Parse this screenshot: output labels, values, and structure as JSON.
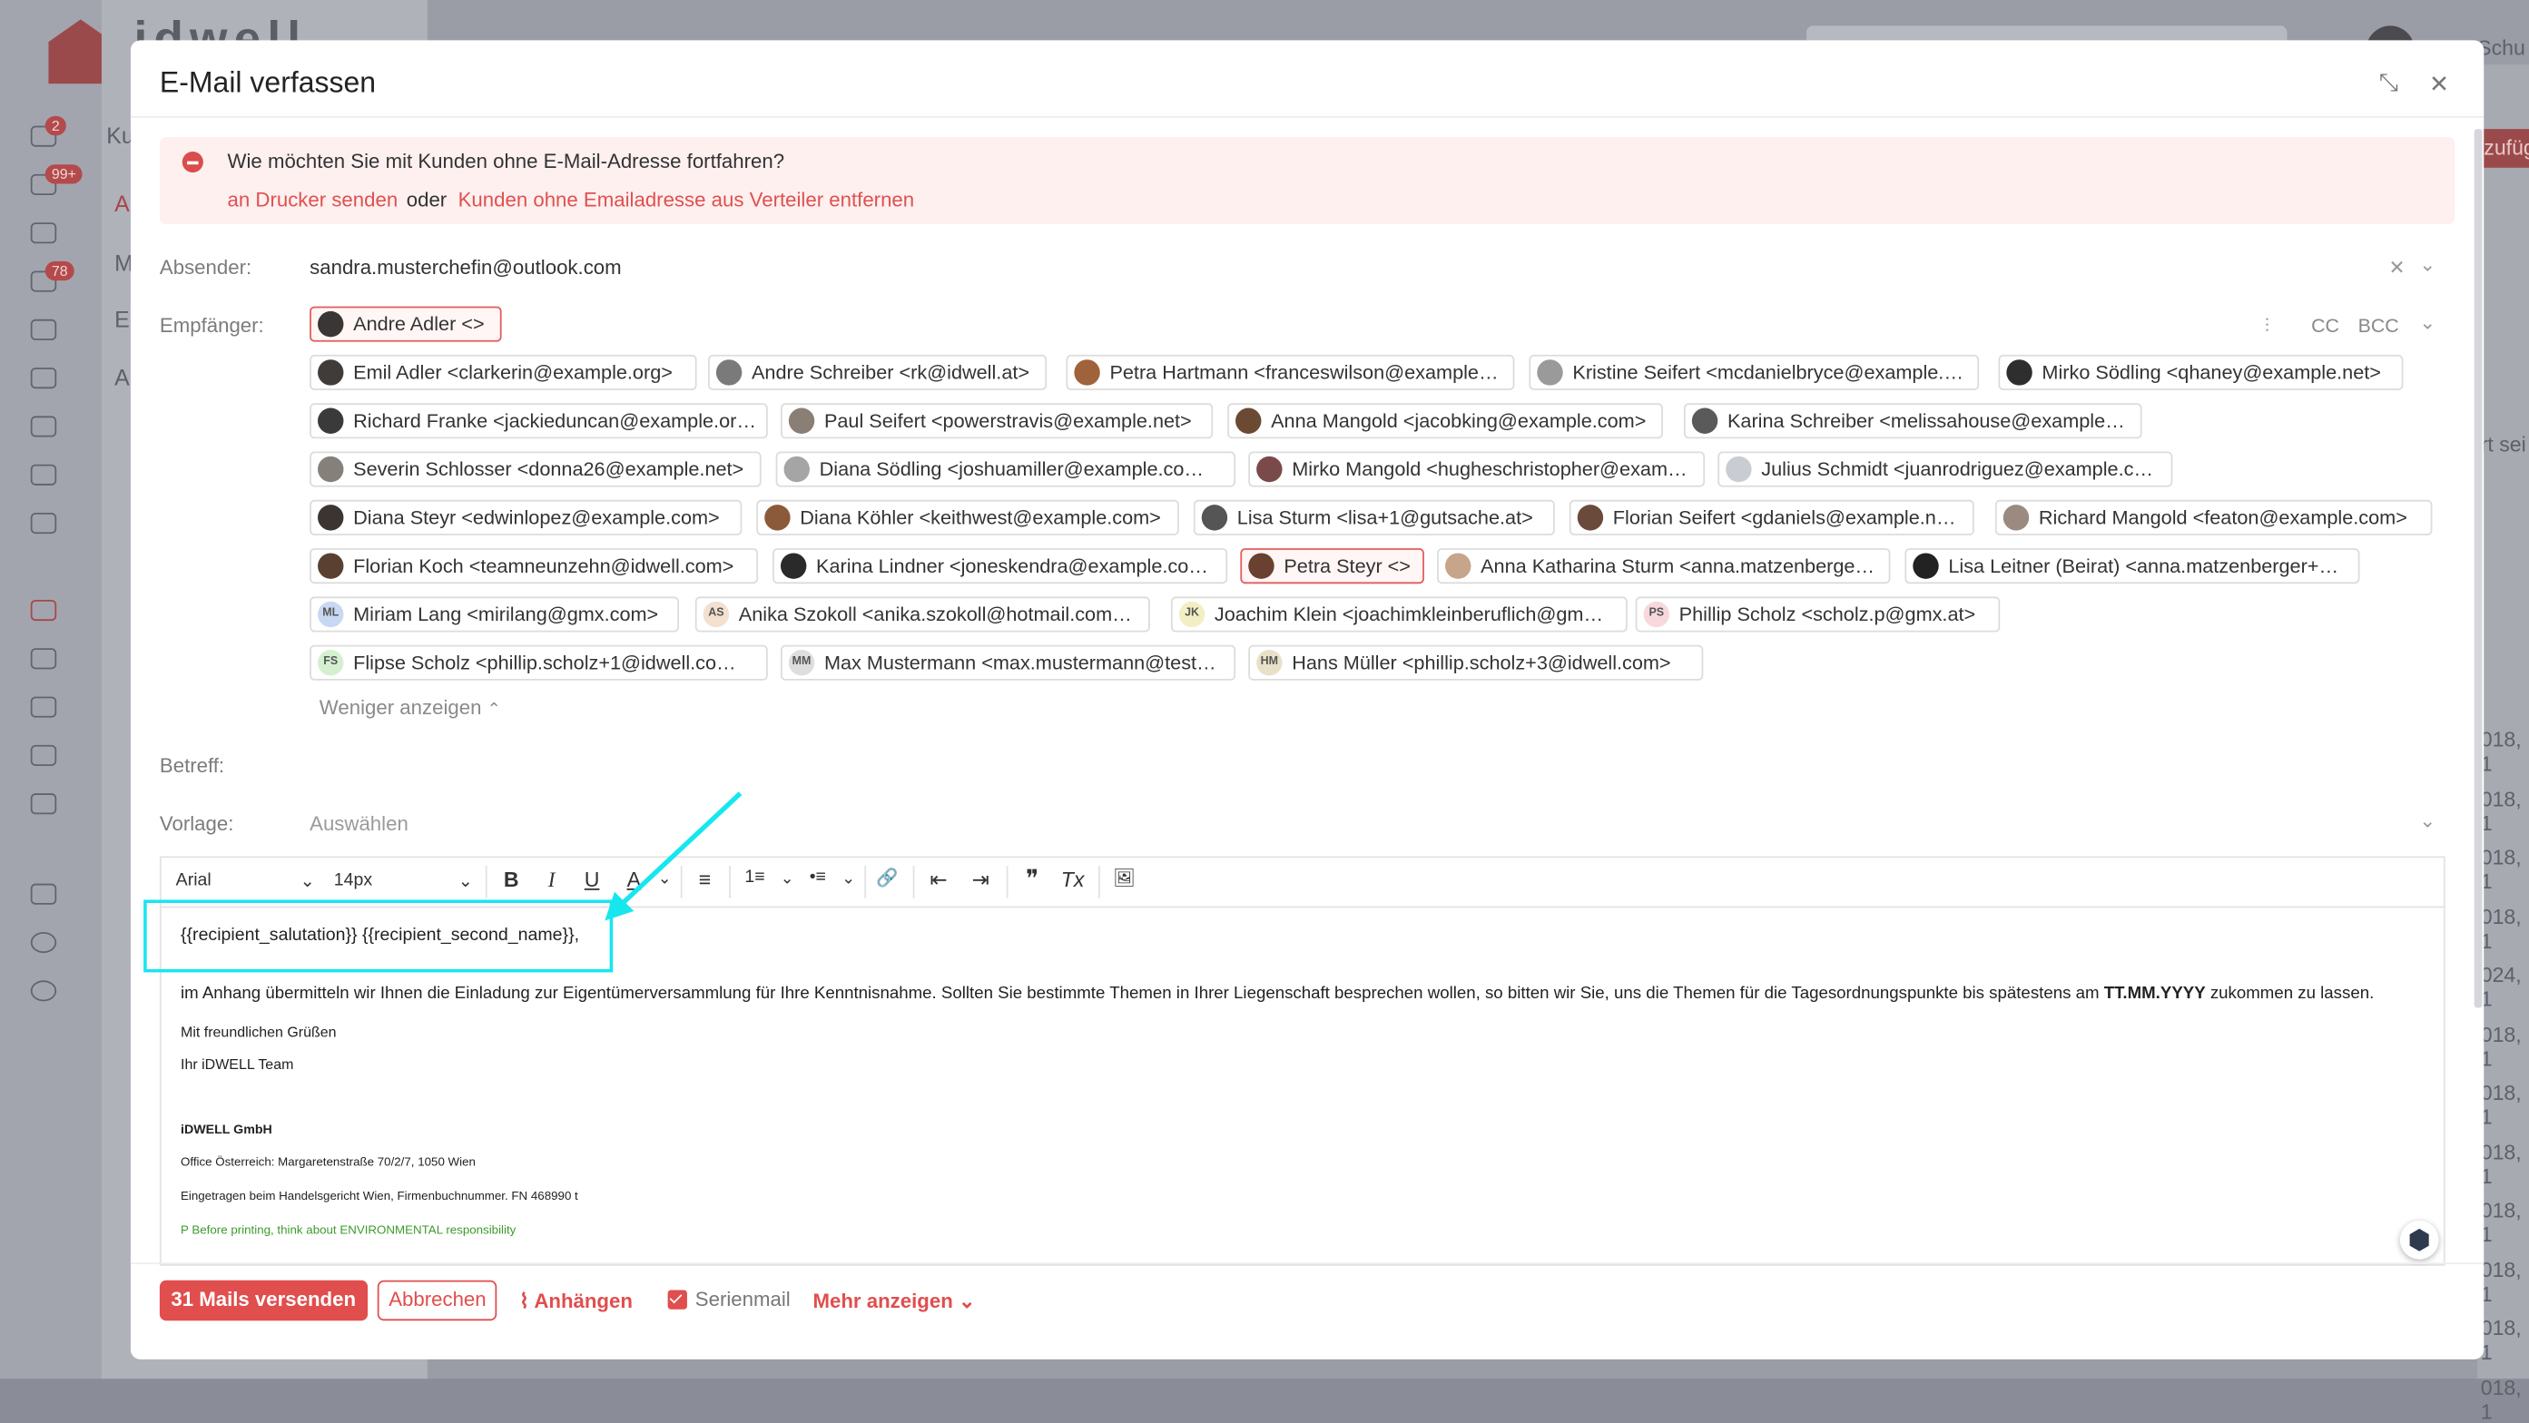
{
  "background": {
    "logo_text": "idwell",
    "nav_badges": [
      "2",
      "99+",
      "78"
    ],
    "nav_texts": [
      "Ku",
      "A",
      "M",
      "E",
      "A"
    ],
    "top_right_text": "Schu",
    "add_button_text": "zufüg",
    "right_column_values": [
      "018, 1",
      "018, 1",
      "018, 1",
      "018, 1",
      "024, 1",
      "018, 1",
      "018, 1",
      "018, 1",
      "018, 1",
      "018, 1",
      "018, 1",
      "018, 1"
    ],
    "side_text": "rt sei"
  },
  "modal": {
    "title": "E-Mail verfassen",
    "minimize_icon": "⤡",
    "close_icon": "✕"
  },
  "alert": {
    "question": "Wie möchten Sie mit Kunden ohne E-Mail-Adresse fortfahren?",
    "option1": "an Drucker senden",
    "or_text": "oder",
    "option2": "Kunden ohne Emailadresse aus Verteiler entfernen"
  },
  "fields": {
    "sender_label": "Absender:",
    "sender_value": "sandra.musterchefin@outlook.com",
    "recipients_label": "Empfänger:",
    "cc": "CC",
    "bcc": "BCC",
    "subject_label": "Betreff:",
    "template_label": "Vorlage:",
    "template_placeholder": "Auswählen"
  },
  "recipients": [
    {
      "label": "Andre Adler <>",
      "highlight": true,
      "avatar": "#3b3636"
    },
    {
      "label": "Emil Adler <clarkerin@example.org>",
      "avatar": "#403c3a"
    },
    {
      "label": "Andre Schreiber <rk@idwell.at>",
      "avatar": "#7a7a7a"
    },
    {
      "label": "Petra Hartmann <franceswilson@example.…",
      "avatar": "#a0623b"
    },
    {
      "label": "Kristine Seifert <mcdanielbryce@example.…",
      "avatar": "#9a9a9a"
    },
    {
      "label": "Mirko Södling <qhaney@example.net>",
      "avatar": "#2e2e2e"
    },
    {
      "label": "Richard Franke <jackieduncan@example.or…",
      "avatar": "#3a3a3a"
    },
    {
      "label": "Paul Seifert <powerstravis@example.net>",
      "avatar": "#8a7f75"
    },
    {
      "label": "Anna Mangold <jacobking@example.com>",
      "avatar": "#6b4a34"
    },
    {
      "label": "Karina Schreiber <melissahouse@example…",
      "avatar": "#5a5a5a"
    },
    {
      "label": "Severin Schlosser <donna26@example.net>",
      "avatar": "#86807a"
    },
    {
      "label": "Diana Södling <joshuamiller@example.co…",
      "avatar": "#a5a5a5"
    },
    {
      "label": "Mirko Mangold <hugheschristopher@exam…",
      "avatar": "#7a4a4a"
    },
    {
      "label": "Julius Schmidt <juanrodriguez@example.c…",
      "avatar": "#c9ccd3"
    },
    {
      "label": "Diana Steyr <edwinlopez@example.com>",
      "avatar": "#3c3430"
    },
    {
      "label": "Diana Köhler <keithwest@example.com>",
      "avatar": "#8a5a3a"
    },
    {
      "label": "Lisa Sturm <lisa+1@gutsache.at>",
      "avatar": "#555"
    },
    {
      "label": "Florian Seifert <gdaniels@example.net>",
      "avatar": "#6a4a3a"
    },
    {
      "label": "Richard Mangold <featon@example.com>",
      "avatar": "#9a8a80"
    },
    {
      "label": "Florian Koch <teamneunzehn@idwell.com>",
      "avatar": "#5a4030"
    },
    {
      "label": "Karina Lindner <joneskendra@example.co…",
      "avatar": "#2a2a2a"
    },
    {
      "label": "Petra Steyr <>",
      "highlight": true,
      "avatar": "#6a4030"
    },
    {
      "label": "Anna Katharina Sturm <anna.matzenberger…",
      "avatar": "#c7a58a"
    },
    {
      "label": "Lisa Leitner (Beirat) <anna.matzenberger+…",
      "avatar": "#222"
    },
    {
      "label": "Miriam Lang <mirilang@gmx.com>",
      "initials": "ML",
      "avatar": "#c9d8f2"
    },
    {
      "label": "Anika Szokoll <anika.szokoll@hotmail.com…",
      "initials": "AS",
      "avatar": "#f3e0cf"
    },
    {
      "label": "Joachim Klein <joachimkleinberuflich@gm…",
      "initials": "JK",
      "avatar": "#f2efc4"
    },
    {
      "label": "Phillip Scholz <scholz.p@gmx.at>",
      "initials": "PS",
      "avatar": "#f6d8dd"
    },
    {
      "label": "Flipse Scholz <phillip.scholz+1@idwell.co…",
      "initials": "FS",
      "avatar": "#d4f0d0"
    },
    {
      "label": "Max Mustermann <max.mustermann@test…",
      "initials": "MM",
      "avatar": "#dedede"
    },
    {
      "label": "Hans Müller <phillip.scholz+3@idwell.com>",
      "initials": "HM",
      "avatar": "#e8e1c8"
    }
  ],
  "show_less": "Weniger anzeigen",
  "editor": {
    "font": "Arial",
    "size": "14px",
    "toolbar_icons": [
      "B",
      "I",
      "U",
      "A",
      "≡",
      "1≡",
      "•≡",
      "🔗",
      "⇤",
      "⇥",
      "❞",
      "Tx",
      "🖼"
    ],
    "salutation": "{{recipient_salutation}} {{recipient_second_name}},",
    "body_pre": "im Anhang übermitteln wir Ihnen die Einladung zur Eigentümerversammlung für Ihre Kenntnisnahme. Sollten Sie bestimmte Themen in Ihrer Liegenschaft besprechen wollen, so bitten wir Sie, uns die Themen für die Tagesordnungspunkte bis spätestens am ",
    "body_bold": "TT.MM.YYYY",
    "body_post": " zukommen zu lassen.",
    "greeting": "Mit freundlichen Grüßen",
    "team": "Ihr iDWELL Team",
    "company": "iDWELL GmbH",
    "office": "Office Österreich: Margaretenstraße 70/2/7, 1050 Wien",
    "register": "Eingetragen beim Handelsgericht Wien, Firmenbuchnummer. FN 468990 t",
    "env": "P Before printing, think about ENVIRONMENTAL responsibility",
    "env_color": "#3e9a2e"
  },
  "footer": {
    "send": "31 Mails versenden",
    "cancel": "Abbrechen",
    "attach": "Anhängen",
    "serienmail": "Serienmail",
    "serienmail_checked": true,
    "more": "Mehr anzeigen"
  },
  "colors": {
    "accent": "#e04e4d",
    "annotation": "#18e6ef"
  }
}
